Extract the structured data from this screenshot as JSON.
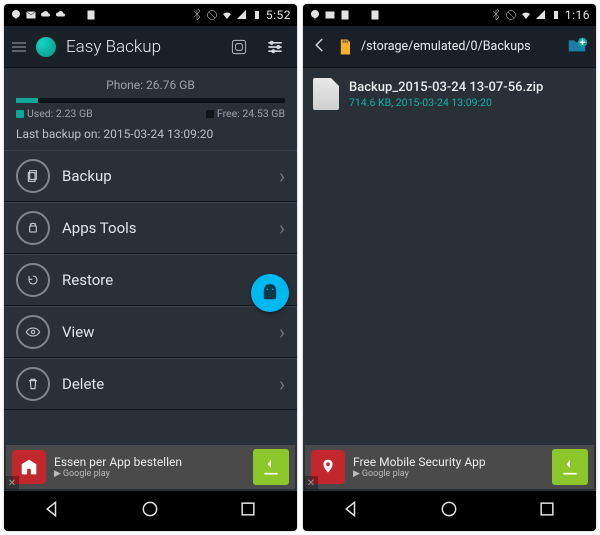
{
  "left": {
    "status_time": "5:52",
    "app_title": "Easy Backup",
    "storage": {
      "phone_label": "Phone: 26.76 GB",
      "used_label": "Used: 2.23 GB",
      "free_label": "Free: 24.53 GB",
      "used_pct": 8
    },
    "last_backup": "Last backup on: 2015-03-24 13:09:20",
    "menu": {
      "backup": "Backup",
      "apps": "Apps Tools",
      "restore": "Restore",
      "view": "View",
      "delete": "Delete"
    },
    "ad": {
      "text": "Essen per App bestellen",
      "store": "Google play",
      "icon_bg": "#c1272d"
    }
  },
  "right": {
    "status_time": "1:16",
    "path": "/storage/emulated/0/Backups",
    "file": {
      "name": "Backup_2015-03-24 13-07-56.zip",
      "meta": "714.6 KB, 2015-03-24 13:09:20"
    },
    "ad": {
      "text": "Free Mobile Security App",
      "store": "Google play",
      "icon_bg": "#c1272d"
    }
  }
}
